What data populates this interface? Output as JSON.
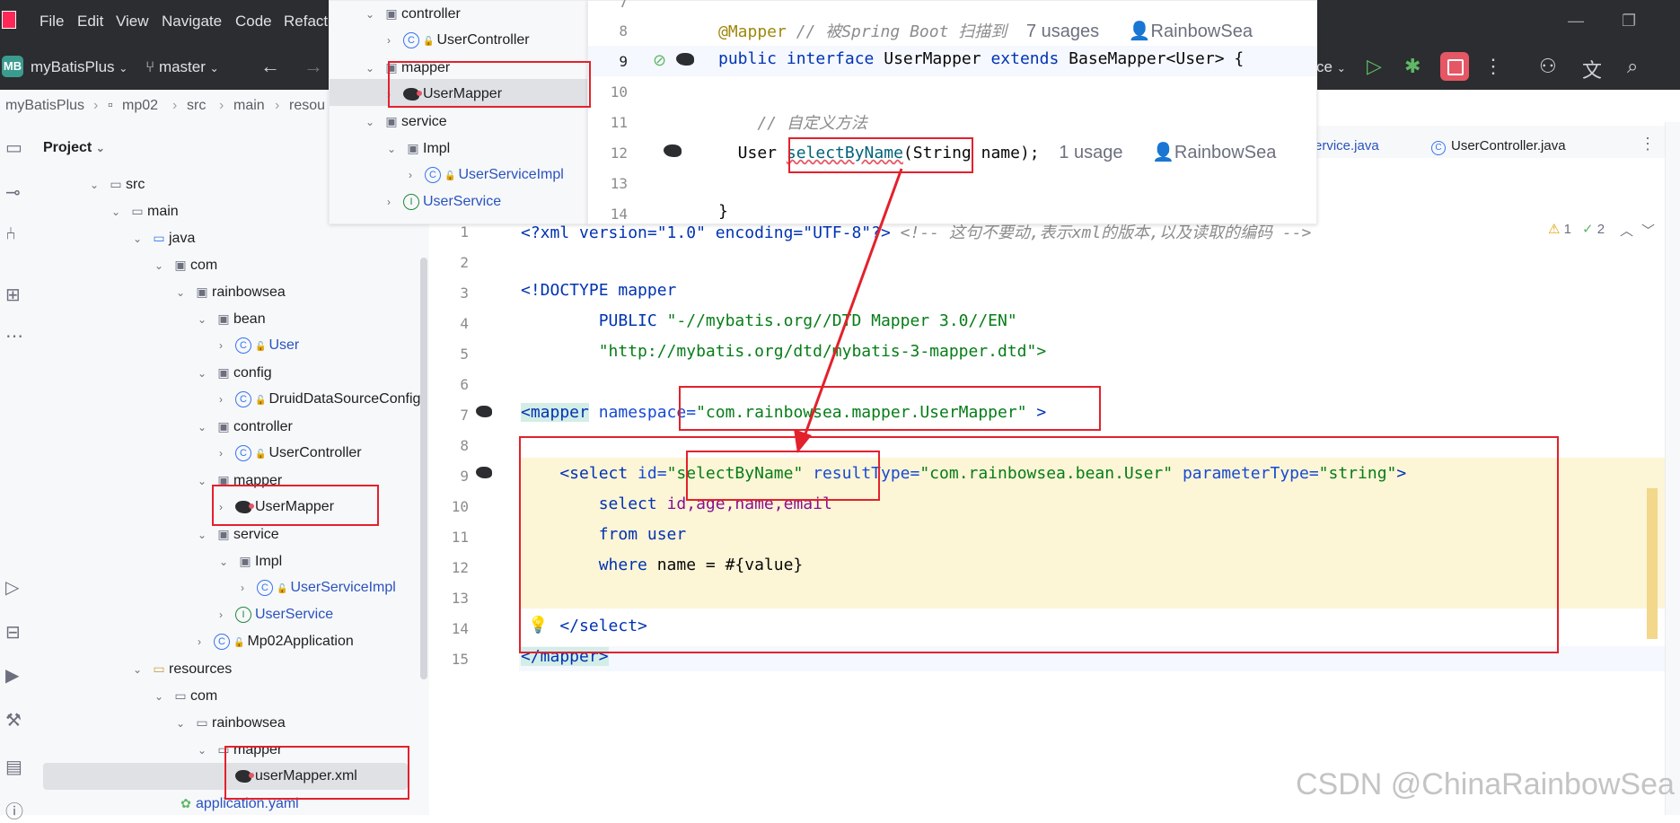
{
  "menubar": {
    "items": [
      "File",
      "Edit",
      "View",
      "Navigate",
      "Code",
      "Refacto"
    ]
  },
  "toolbar": {
    "project_badge": "MB",
    "project_name": "myBatisPlus",
    "branch": "master",
    "run_config_partial": "ce"
  },
  "breadcrumb": [
    "myBatisPlus",
    "mp02",
    "src",
    "main",
    "resou"
  ],
  "project_panel": {
    "title": "Project",
    "rows": [
      {
        "label": "src",
        "kind": "folder"
      },
      {
        "label": "main",
        "kind": "folder"
      },
      {
        "label": "java",
        "kind": "folder"
      },
      {
        "label": "com",
        "kind": "package"
      },
      {
        "label": "rainbowsea",
        "kind": "package"
      },
      {
        "label": "bean",
        "kind": "package"
      },
      {
        "label": "User",
        "kind": "class"
      },
      {
        "label": "config",
        "kind": "package"
      },
      {
        "label": "DruidDataSourceConfig",
        "kind": "class"
      },
      {
        "label": "controller",
        "kind": "package"
      },
      {
        "label": "UserController",
        "kind": "class"
      },
      {
        "label": "mapper",
        "kind": "package"
      },
      {
        "label": "UserMapper",
        "kind": "mybatis"
      },
      {
        "label": "service",
        "kind": "package"
      },
      {
        "label": "Impl",
        "kind": "package"
      },
      {
        "label": "UserServiceImpl",
        "kind": "class"
      },
      {
        "label": "UserService",
        "kind": "interface"
      },
      {
        "label": "Mp02Application",
        "kind": "class"
      },
      {
        "label": "resources",
        "kind": "folder"
      },
      {
        "label": "com",
        "kind": "folder"
      },
      {
        "label": "rainbowsea",
        "kind": "folder"
      },
      {
        "label": "mapper",
        "kind": "folder"
      },
      {
        "label": "userMapper.xml",
        "kind": "mybatis"
      },
      {
        "label": "application.yaml",
        "kind": "config"
      }
    ]
  },
  "tabs": [
    "ervice.java",
    "UserController.java"
  ],
  "inspections": {
    "warnings": "1",
    "checks": "2"
  },
  "xml_lines": [
    {
      "n": "1"
    },
    {
      "n": "2"
    },
    {
      "n": "3"
    },
    {
      "n": "4"
    },
    {
      "n": "5"
    },
    {
      "n": "6"
    },
    {
      "n": "7"
    },
    {
      "n": "8"
    },
    {
      "n": "9"
    },
    {
      "n": "10"
    },
    {
      "n": "11"
    },
    {
      "n": "12"
    },
    {
      "n": "13"
    },
    {
      "n": "14"
    },
    {
      "n": "15"
    }
  ],
  "xml": {
    "l1_decl": "<?xml version=\"1.0\" encoding=\"UTF-8\"?>",
    "l1_comment": " <!-- 这句不要动,表示xml的版本,以及读取的编码 -->",
    "l3": "<!DOCTYPE mapper",
    "l4a": "        PUBLIC ",
    "l4b": "\"-//mybatis.org//DTD Mapper 3.0//EN\"",
    "l5": "        \"http://mybatis.org/dtd/mybatis-3-mapper.dtd\">",
    "l7_open": "<mapper",
    "l7_attr": " namespace=",
    "l7_val": "\"com.rainbowsea.mapper.UserMapper\"",
    "l7_close": " >",
    "l9_tag": "    <select",
    "l9_id": " id=",
    "l9_idval": "\"selectByName\"",
    "l9_rt": " resultType=",
    "l9_rtval": "\"com.rainbowsea.bean.User\"",
    "l9_pt": " parameterType=",
    "l9_ptval": "\"string\"",
    "l9_end": ">",
    "l10_kw": "        select ",
    "l10_cols": "id,age,name,email",
    "l11": "        from user",
    "l12_kw": "        where ",
    "l12_rest": "name = #{value}",
    "l14": "    </select>",
    "l15": "</mapper>"
  },
  "overlay_tree": {
    "rows": [
      {
        "label": "controller"
      },
      {
        "label": "UserController"
      },
      {
        "label": "mapper"
      },
      {
        "label": "UserMapper"
      },
      {
        "label": "service"
      },
      {
        "label": "Impl"
      },
      {
        "label": "UserServiceImpl"
      },
      {
        "label": "UserService"
      }
    ]
  },
  "overlay_code": {
    "line_numbers": [
      "7",
      "8",
      "9",
      "10",
      "11",
      "12",
      "13",
      "14"
    ],
    "l8_ann": "@Mapper",
    "l8_comment": " // 被Spring Boot 扫描到",
    "l8_usages": "7 usages",
    "l8_author": "RainbowSea",
    "l9_a": "public interface ",
    "l9_b": "UserMapper",
    "l9_c": " extends ",
    "l9_d": "BaseMapper<User> {",
    "l11_comment": "    // 自定义方法",
    "l12_a": "  User ",
    "l12_b": "selectByName",
    "l12_c": "(String name);",
    "l12_usages": "1 usage",
    "l12_author": "RainbowSea",
    "l14": "}"
  },
  "watermark": "CSDN @ChinaRainbowSea"
}
